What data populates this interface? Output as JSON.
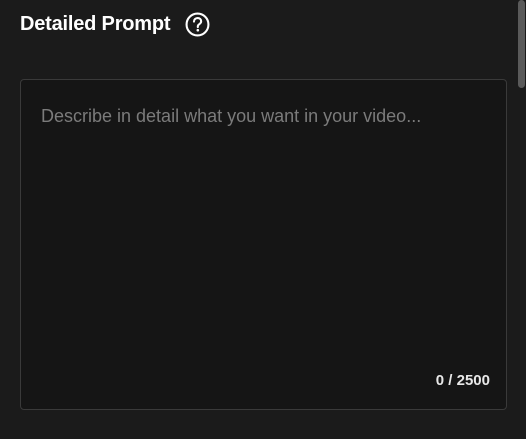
{
  "section": {
    "title": "Detailed Prompt",
    "help_icon": "question-circle-icon"
  },
  "prompt": {
    "value": "",
    "placeholder": "Describe in detail what you want in your video...",
    "counter": "0 / 2500",
    "max_length": 2500
  },
  "colors": {
    "background": "#1b1b1b",
    "field_background": "#151515",
    "field_border": "#3a3a3a",
    "text": "#ffffff",
    "placeholder": "#7b7b7b"
  }
}
